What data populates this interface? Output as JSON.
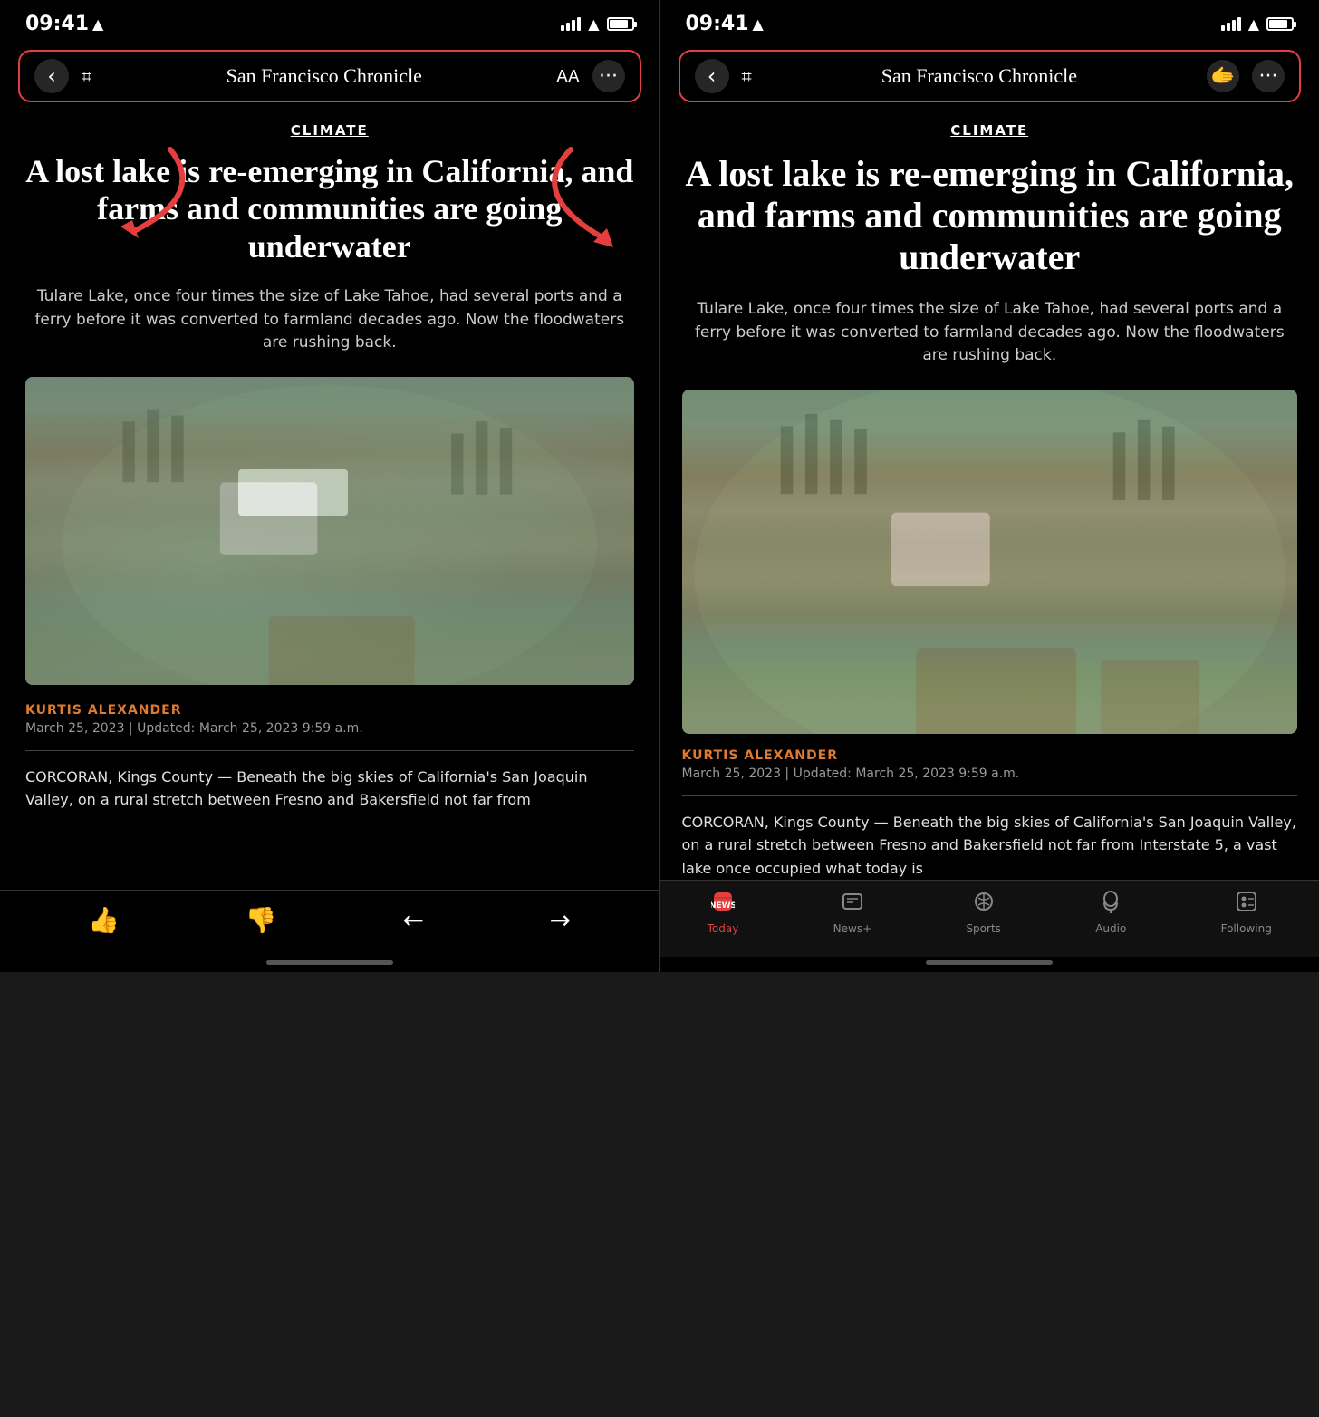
{
  "phones": {
    "left": {
      "status": {
        "time": "09:41",
        "location_arrow": "▲"
      },
      "nav": {
        "back_label": "‹",
        "bookmark_label": "🔖",
        "title": "San Francisco Chronicle",
        "aa_label": "AA",
        "more_label": "···"
      },
      "article": {
        "category": "CLIMATE",
        "headline": "A lost lake is re-emerging in California, and farms and communities are going underwater",
        "subtitle": "Tulare Lake, once four times the size of Lake Tahoe, had several ports and a ferry before it was converted to farmland decades ago. Now the floodwaters are rushing back.",
        "author": "KURTIS ALEXANDER",
        "date": "March 25, 2023 | Updated: March 25, 2023 9:59 a.m.",
        "body": "CORCORAN, Kings County — Beneath the big skies of California's San Joaquin Valley, on a rural stretch between Fresno and Bakersfield not far from"
      },
      "toolbar": {
        "thumbup": "👍",
        "thumbdown": "👎",
        "back_arrow": "←",
        "forward_arrow": "→"
      }
    },
    "right": {
      "status": {
        "time": "09:41",
        "location_arrow": "▲"
      },
      "nav": {
        "back_label": "‹",
        "bookmark_label": "🔖",
        "title": "San Francisco Chronicle",
        "face_label": "🫱",
        "more_label": "···"
      },
      "article": {
        "category": "CLIMATE",
        "headline": "A lost lake is re-emerging in California, and farms and communities are going underwater",
        "subtitle": "Tulare Lake, once four times the size of Lake Tahoe, had several ports and a ferry before it was converted to farmland decades ago. Now the floodwaters are rushing back.",
        "author": "KURTIS ALEXANDER",
        "date": "March 25, 2023 | Updated: March 25, 2023 9:59 a.m.",
        "body": "CORCORAN, Kings County — Beneath the big skies of California's San Joaquin Valley, on a rural stretch between Fresno and Bakersfield not far from Interstate 5, a vast lake once occupied what today is"
      },
      "tabbar": {
        "tabs": [
          {
            "label": "Today",
            "active": true
          },
          {
            "label": "News+",
            "active": false
          },
          {
            "label": "Sports",
            "active": false
          },
          {
            "label": "Audio",
            "active": false
          },
          {
            "label": "Following",
            "active": false
          }
        ]
      }
    }
  }
}
